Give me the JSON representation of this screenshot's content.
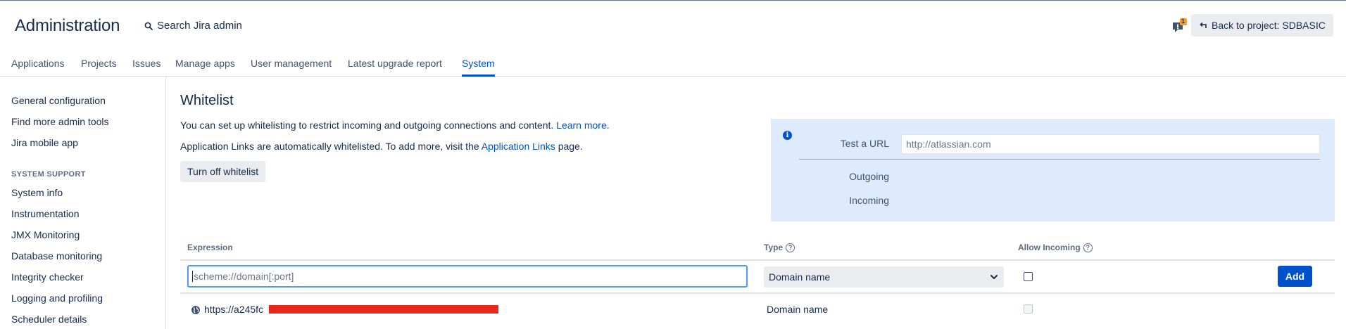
{
  "header": {
    "title": "Administration",
    "search_label": "Search Jira admin",
    "notification_count": "1",
    "back_label": "Back to project: SDBASIC"
  },
  "nav": {
    "tabs": [
      {
        "label": "Applications"
      },
      {
        "label": "Projects"
      },
      {
        "label": "Issues"
      },
      {
        "label": "Manage apps"
      },
      {
        "label": "User management"
      },
      {
        "label": "Latest upgrade report"
      },
      {
        "label": "System",
        "active": true
      }
    ]
  },
  "sidebar": {
    "items": [
      {
        "label": "General configuration"
      },
      {
        "label": "Find more admin tools"
      },
      {
        "label": "Jira mobile app"
      }
    ],
    "section_title": "SYSTEM SUPPORT",
    "support_items": [
      {
        "label": "System info"
      },
      {
        "label": "Instrumentation"
      },
      {
        "label": "JMX Monitoring"
      },
      {
        "label": "Database monitoring"
      },
      {
        "label": "Integrity checker"
      },
      {
        "label": "Logging and profiling"
      },
      {
        "label": "Scheduler details"
      }
    ]
  },
  "main": {
    "title": "Whitelist",
    "intro_text": "You can set up whitelisting to restrict incoming and outgoing connections and content.",
    "learn_more": "Learn more",
    "period": ".",
    "applinks_text": "Application Links are automatically whitelisted. To add more, visit the",
    "applinks_link": "Application Links",
    "applinks_suffix": "page.",
    "turn_off_label": "Turn off whitelist"
  },
  "test_panel": {
    "test_label": "Test a URL",
    "test_placeholder": "http://atlassian.com",
    "outgoing_label": "Outgoing",
    "incoming_label": "Incoming"
  },
  "table": {
    "headers": {
      "expression": "Expression",
      "type": "Type",
      "allow_incoming": "Allow Incoming"
    },
    "new_row": {
      "expression_placeholder": "scheme://domain[:port]",
      "type_value": "Domain name",
      "add_label": "Add"
    },
    "rows": [
      {
        "expression": "https://a245fc",
        "type": "Domain name",
        "allow_incoming": false
      }
    ]
  },
  "colors": {
    "accent": "#0052cc",
    "panel_bg": "#deebff",
    "focus": "#4c9aff",
    "redaction": "#e8281d"
  }
}
